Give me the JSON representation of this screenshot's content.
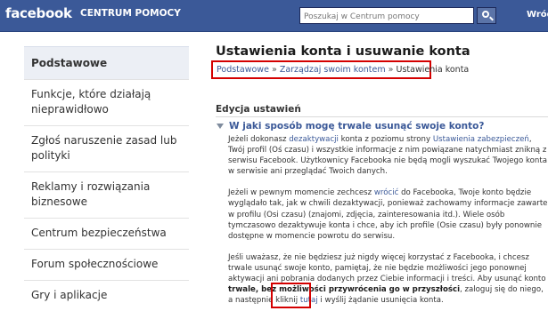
{
  "header": {
    "logo": "facebook",
    "section_title": "CENTRUM POMOCY",
    "search_placeholder": "Poszukaj w Centrum pomocy",
    "user_link": "Wród"
  },
  "sidebar": {
    "items": [
      {
        "label": "Podstawowe",
        "active": true
      },
      {
        "label": "Funkcje, które działają nieprawidłowo"
      },
      {
        "label": "Zgłoś naruszenie zasad lub polityki"
      },
      {
        "label": "Reklamy i rozwiązania biznesowe"
      },
      {
        "label": "Centrum bezpieczeństwa"
      },
      {
        "label": "Forum społecznościowe"
      },
      {
        "label": "Gry i aplikacje"
      }
    ]
  },
  "main": {
    "title": "Ustawienia konta i usuwanie konta",
    "breadcrumb": [
      {
        "label": "Podstawowe"
      },
      {
        "label": "Zarządzaj swoim kontem"
      },
      {
        "label": "Ustawienia konta"
      }
    ],
    "breadcrumb_separator": "»",
    "section_heading": "Edycja ustawień",
    "question": "W jaki sposób mogę trwale usunąć swoje konto?",
    "p1": {
      "t1": "Jeżeli dokonasz ",
      "link1": "dezaktywacji",
      "t2": " konta z poziomu strony ",
      "link2": "Ustawienia zabezpieczeń",
      "t3": ", Twój profil (Oś czasu) i wszystkie informacje z nim powiązane natychmiast znikną z serwisu Facebook. Użytkownicy Facebooka nie będą mogli wyszukać Twojego konta w serwisie ani przeglądać Twoich danych."
    },
    "p2": {
      "t1": "Jeżeli w pewnym momencie zechcesz ",
      "link1": "wrócić",
      "t2": " do Facebooka, Twoje konto będzie wyglądało tak, jak w chwili dezaktywacji, ponieważ zachowamy informacje zawarte w profilu (Osi czasu) (znajomi, zdjęcia, zainteresowania itd.). Wiele osób tymczasowo dezaktywuje konta i chce, aby ich profile (Osie czasu) były ponownie dostępne w momencie powrotu do serwisu."
    },
    "p3": {
      "t1": "Jeśli uważasz, że nie będziesz już nigdy więcej korzystać z Facebooka, i chcesz trwale usunąć swoje konto, pamiętaj, że nie będzie możliwości jego ponownej aktywacji ani pobrania dodanych przez Ciebie informacji i treści. Aby usunąć konto ",
      "bold": "trwale, bez możliwości przywrócenia go w przyszłości",
      "t2": ", zaloguj się do niego, a następnie kliknij ",
      "link": "tutaj",
      "t3": " i wyślij żądanie usunięcia konta."
    }
  },
  "colors": {
    "brand_blue": "#3b5998",
    "annotation_red": "#d40000",
    "sidebar_active_bg": "#eceff5"
  },
  "icons": {
    "search": "magnifier-icon",
    "question_toggle": "triangle-down-icon"
  }
}
